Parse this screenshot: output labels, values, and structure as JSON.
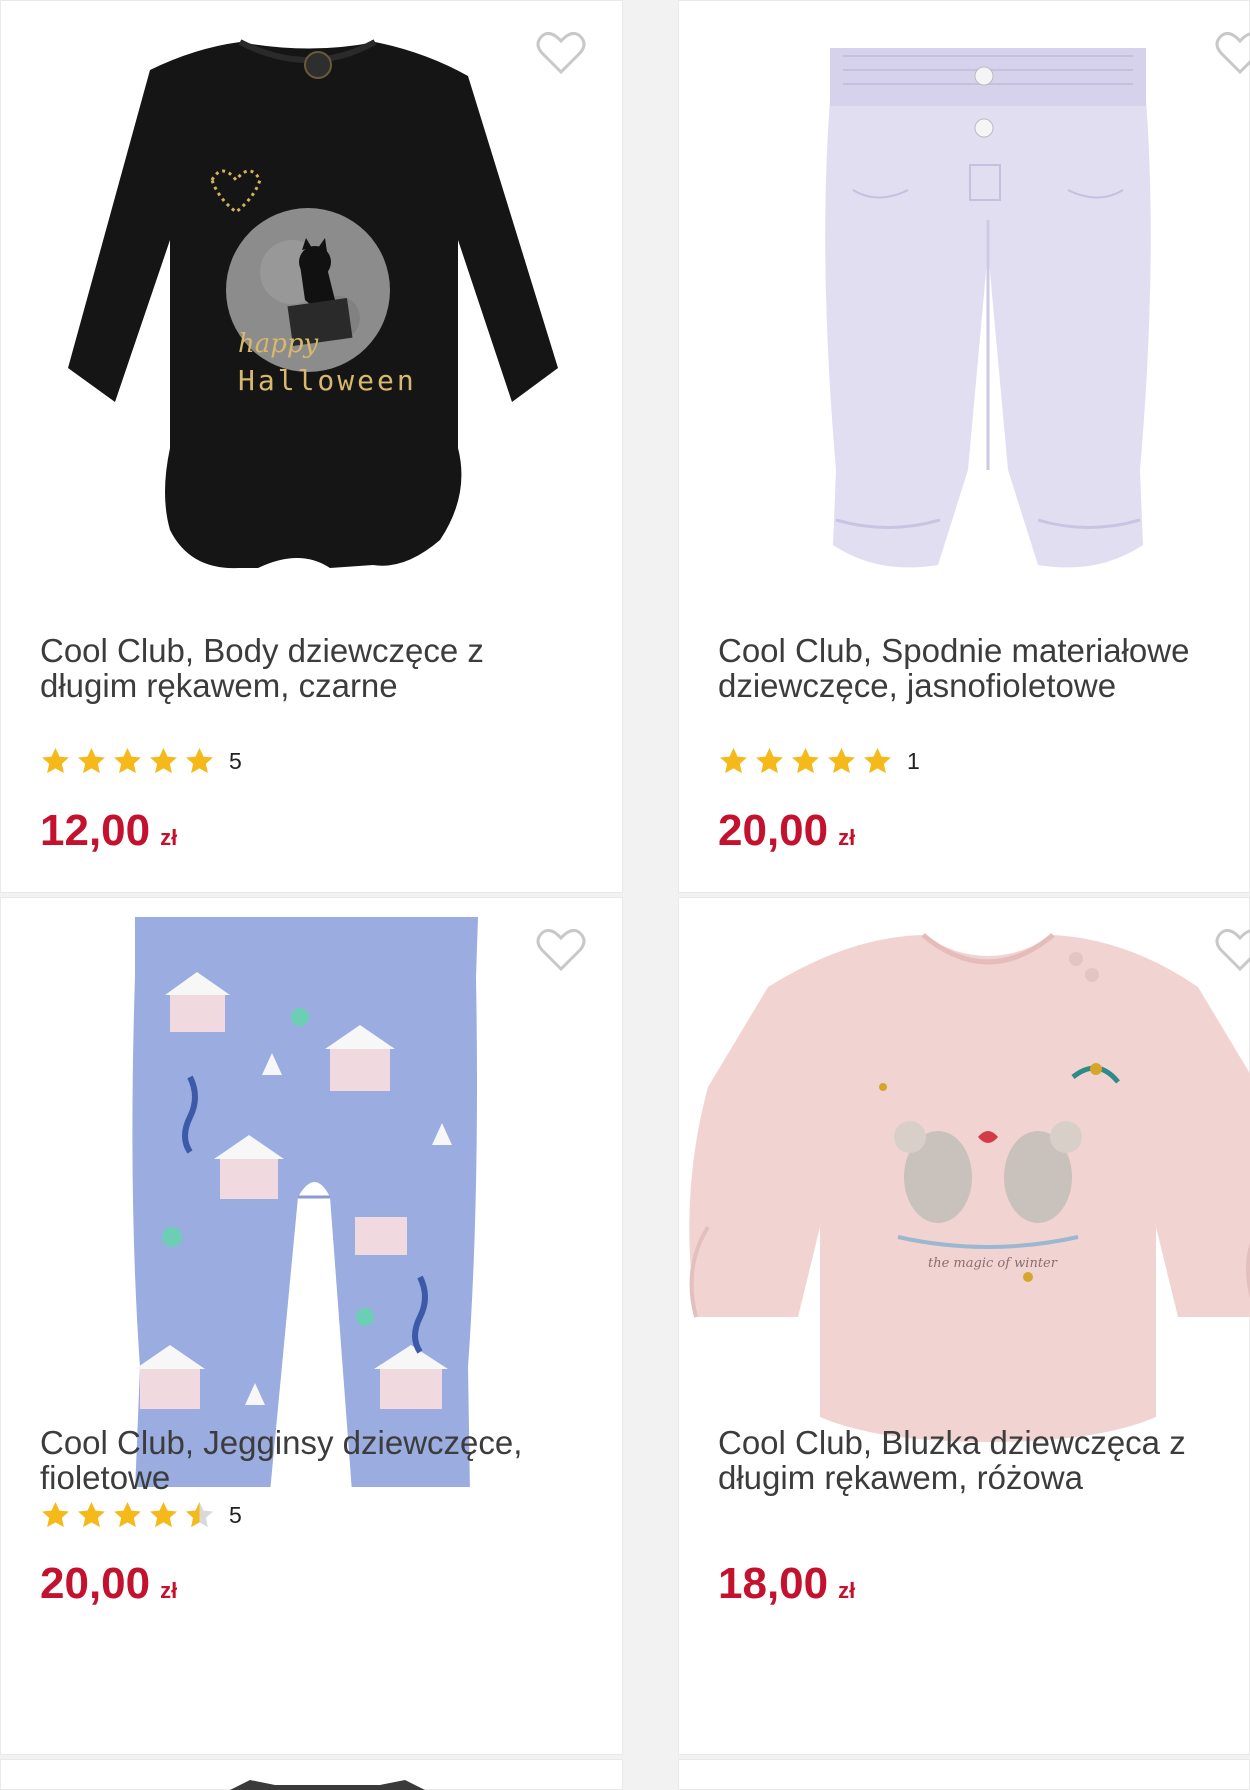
{
  "products": [
    {
      "title": "Cool Club, Body dziewczęce z długim rękawem, czarne",
      "rating": 5,
      "rating_count": "5",
      "price": "12,00",
      "currency": "zł",
      "image": "black-halloween-bodysuit",
      "print_text": "happy Halloween"
    },
    {
      "title": "Cool Club, Spodnie materiałowe dziewczęce, jasnofioletowe",
      "rating": 5,
      "rating_count": "1",
      "price": "20,00",
      "currency": "zł",
      "image": "lilac-fabric-trousers"
    },
    {
      "title": "Cool Club, Jegginsy dziewczęce, fioletowe",
      "rating": 4.5,
      "rating_count": "5",
      "price": "20,00",
      "currency": "zł",
      "image": "blue-winter-print-jeggings"
    },
    {
      "title": "Cool Club, Bluzka dziewczęca z długim rękawem, różowa",
      "price": "18,00",
      "currency": "zł",
      "image": "pink-mouse-print-blouse"
    }
  ],
  "colors": {
    "price": "#c3112e",
    "star": "#f6b91a",
    "star_empty": "#d9d9d9",
    "heart": "#c8c8c8",
    "background": "#f2f2f2"
  },
  "icons": [
    "heart-outline-icon",
    "star-icon"
  ]
}
